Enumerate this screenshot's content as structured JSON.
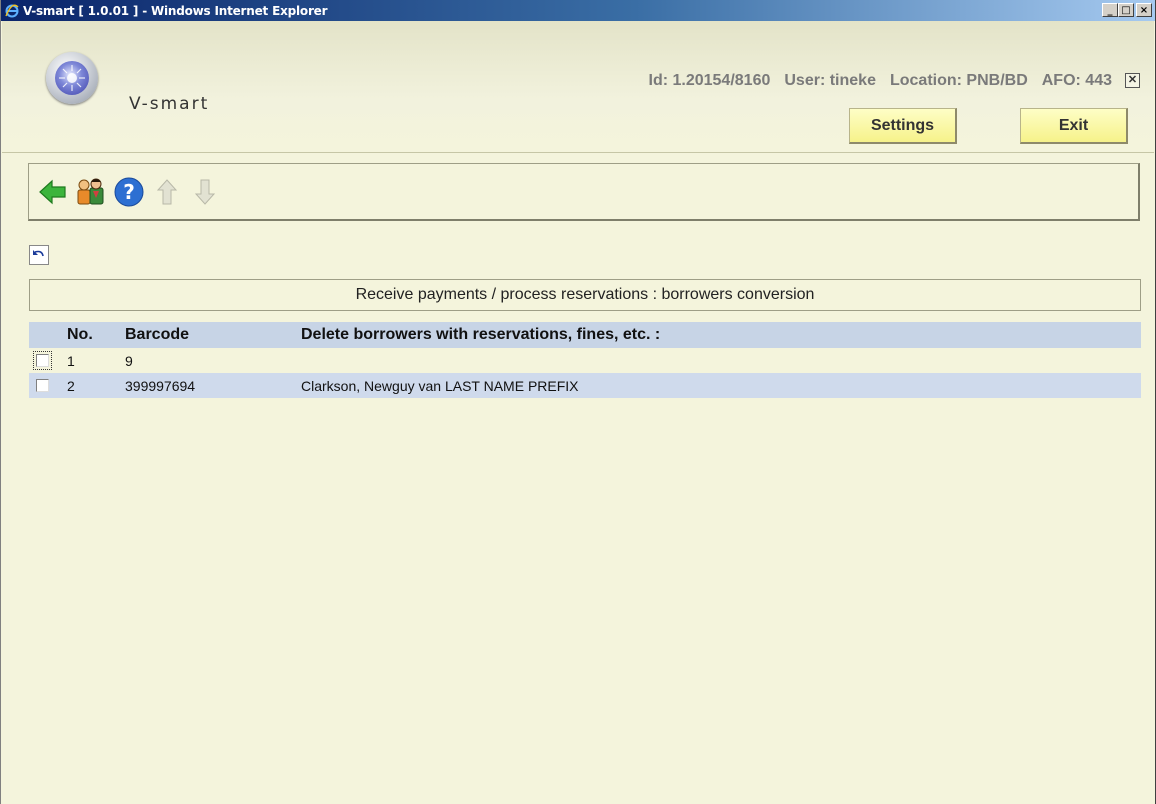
{
  "window": {
    "title": "V-smart [ 1.0.01 ] - Windows Internet Explorer",
    "minimize": "_",
    "maximize": "□",
    "close": "×"
  },
  "header": {
    "logo_text": "V-smart",
    "session": {
      "id": "Id: 1.20154/8160",
      "user": "User: tineke",
      "location": "Location: PNB/BD",
      "afo": "AFO: 443"
    },
    "close_mark": "✕",
    "settings_label": "Settings",
    "exit_label": "Exit"
  },
  "toolbar": {
    "icons": [
      "back-arrow-icon",
      "borrowers-icon",
      "help-icon",
      "up-arrow-icon",
      "down-arrow-icon"
    ]
  },
  "page": {
    "heading": "Receive payments / process reservations : borrowers conversion"
  },
  "table": {
    "headers": {
      "no": "No.",
      "barcode": "Barcode",
      "name": "Delete borrowers with reservations, fines, etc. :"
    },
    "rows": [
      {
        "no": "1",
        "barcode": "9",
        "name": ""
      },
      {
        "no": "2",
        "barcode": "399997694",
        "name": "Clarkson, Newguy van LAST NAME PREFIX"
      }
    ]
  },
  "colors": {
    "background": "#f4f4dc",
    "button": "#f6f28a",
    "table_header": "#c7d4e6",
    "row_alt": "#cfdaec"
  }
}
